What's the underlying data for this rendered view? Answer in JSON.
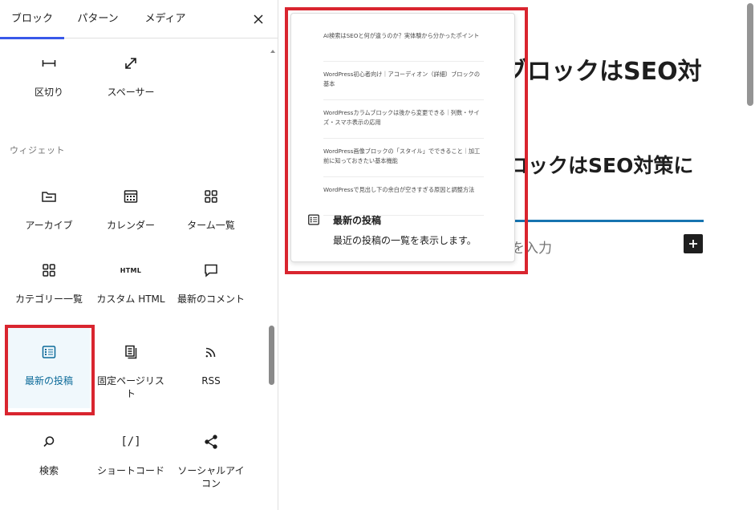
{
  "tabs": [
    "ブロック",
    "パターン",
    "メディア"
  ],
  "close_label": "×",
  "blocks_top": [
    {
      "icon": "separator-icon",
      "label": "区切り"
    },
    {
      "icon": "spacer-icon",
      "label": "スペーサー"
    }
  ],
  "section_widgets": "ウィジェット",
  "widgets": [
    {
      "icon": "archive-icon",
      "label": "アーカイブ"
    },
    {
      "icon": "calendar-icon",
      "label": "カレンダー"
    },
    {
      "icon": "term-list-icon",
      "label": "ターム一覧"
    },
    {
      "icon": "categories-icon",
      "label": "カテゴリー一覧"
    },
    {
      "icon": "html-icon",
      "label": "カスタム HTML",
      "icon_text": "HTML"
    },
    {
      "icon": "comment-icon",
      "label": "最新のコメント"
    },
    {
      "icon": "latest-posts-icon",
      "label": "最新の投稿",
      "selected": true
    },
    {
      "icon": "page-list-icon",
      "label": "固定ページリスト"
    },
    {
      "icon": "rss-icon",
      "label": "RSS"
    },
    {
      "icon": "search-icon",
      "label": "検索"
    },
    {
      "icon": "shortcode-icon",
      "label": "ショートコード",
      "icon_text": "[/]"
    },
    {
      "icon": "share-icon",
      "label": "ソーシャルアイコン"
    }
  ],
  "canvas": {
    "heading_1": "ブロックはSEO対",
    "heading_2": "ロックはSEO対策に",
    "placeholder": "を入力",
    "plus_label": "+"
  },
  "preview": {
    "posts": [
      "AI検索はSEOと何が違うのか？実体験から分かったポイント",
      "WordPress初心者向け｜アコーディオン（詳細）ブロックの基本",
      "WordPressカラムブロックは後から変更できる｜列数・サイズ・スマホ表示の応用",
      "WordPress画像ブロックの「スタイル」でできること｜加工前に知っておきたい基本機能",
      "WordPressで見出し下の余白が空きすぎる原因と調整方法"
    ],
    "title": "最新の投稿",
    "description": "最近の投稿の一覧を表示します。"
  },
  "colors": {
    "accent": "#3858e9",
    "selected": "#0b6a99",
    "highlight": "#d9252f",
    "link_line": "#1674b0"
  }
}
